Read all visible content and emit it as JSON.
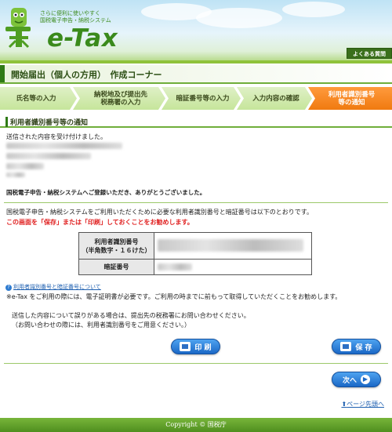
{
  "header": {
    "tagline_line1": "さらに便利に使いやすく",
    "tagline_line2": "国税電子申告・納税システム",
    "logo_text": "e-Tax",
    "faq_label": "よくある質問"
  },
  "page_title": "開始届出（個人の方用）　作成コーナー",
  "steps": [
    {
      "label": "氏名等の入力",
      "state": "done"
    },
    {
      "label": "納税地及び提出先税務署の入力",
      "line1": "納税地及び提出先",
      "line2": "税務署の入力",
      "state": "done"
    },
    {
      "label": "暗証番号等の入力",
      "state": "done"
    },
    {
      "label": "入力内容の確認",
      "state": "done"
    },
    {
      "label": "利用者識別番号等の通知",
      "line1": "利用者識別番号",
      "line2": "等の通知",
      "state": "active"
    }
  ],
  "section_heading": "利用者識別番号等の通知",
  "received_msg": "送信された内容を受け付けました。",
  "thanks_msg": "国税電子申告・納税システムへご登録いただき、ありがとうございました。",
  "notice_msg": "国税電子申告・納税システムをご利用いただくために必要な利用者識別番号と暗証番号は以下のとおりです。",
  "warning_msg": "この画面を「保存」または「印刷」しておくことをお勧めします。",
  "table": {
    "id_label_line1": "利用者識別番号",
    "id_label_line2": "（半角数字・１６けた）",
    "pin_label": "暗証番号"
  },
  "help_link": "利用者識別番号と暗証番号について",
  "cert_note": "※e-Tax をご利用の際には、電子証明書が必要です。ご利用の時までに前もって取得していただくことをお勧めします。",
  "contact_line1": "送信した内容について誤りがある場合は、提出先の税務署にお問い合わせください。",
  "contact_line2": "（お問い合わせの際には、利用者識別番号をご用意ください。）",
  "buttons": {
    "print": "印 刷",
    "save": "保 存",
    "next": "次へ"
  },
  "page_top_link": "ページ先頭へ",
  "footer": "Copyright © 国税庁",
  "colors": {
    "brand_green": "#3a8a1c",
    "active_step": "#f07a10",
    "warning": "#e02020",
    "button_blue": "#1b68c6"
  }
}
